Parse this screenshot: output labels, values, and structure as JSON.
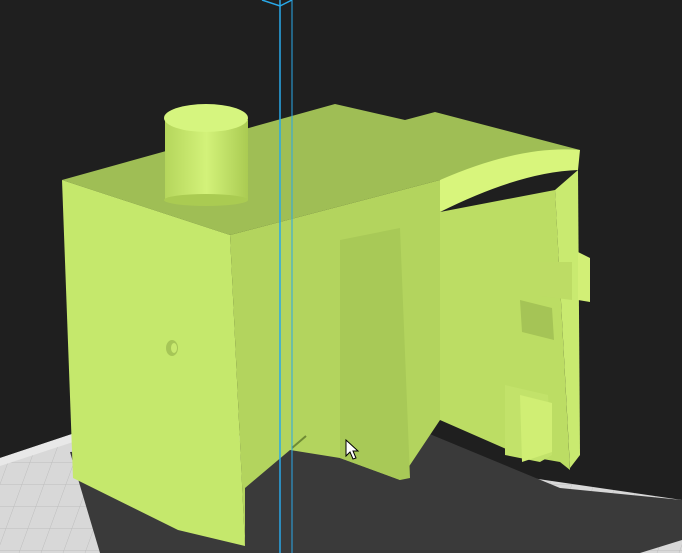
{
  "viewport": {
    "background_color": "#1f1f1f",
    "model_color": "#c5e86c",
    "build_plate_color": "#d6d6d6",
    "shadow_color": "#333333",
    "axis_line_color": "#29a8e8",
    "cursor_icon": "arrow-cursor-icon"
  }
}
